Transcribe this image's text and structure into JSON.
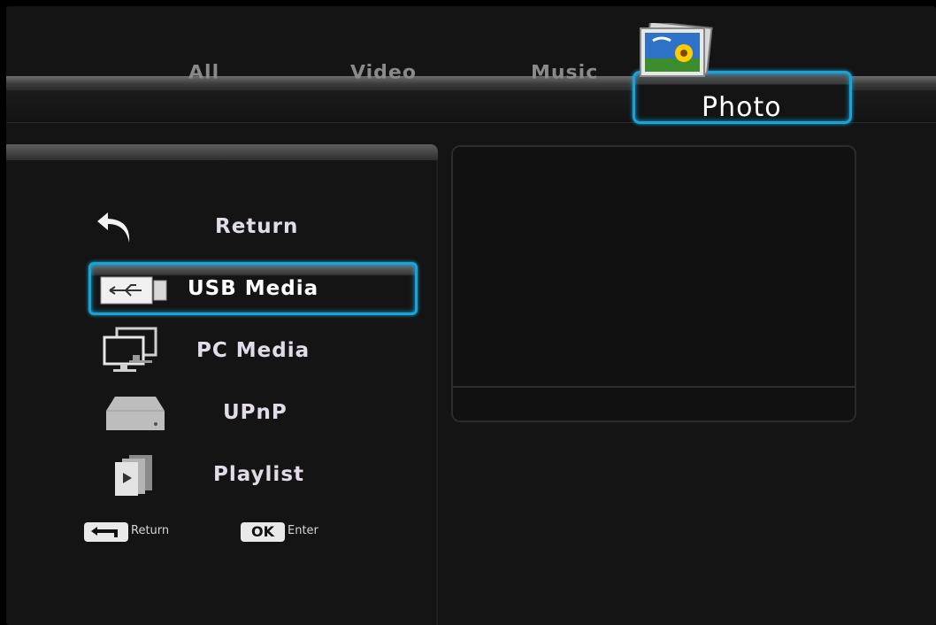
{
  "tabs": {
    "all": "All",
    "video": "Video",
    "music": "Music",
    "photo": "Photo",
    "selected": "Photo"
  },
  "menu": [
    {
      "label": "Return",
      "icon": "return-arrow-icon"
    },
    {
      "label": "USB Media",
      "icon": "usb-icon"
    },
    {
      "label": "PC Media",
      "icon": "pc-icon"
    },
    {
      "label": "UPnP",
      "icon": "upnp-drive-icon"
    },
    {
      "label": "Playlist",
      "icon": "playlist-icon"
    }
  ],
  "selected_item": "USB Media",
  "hints": {
    "return_label": "Return",
    "ok_key": "OK",
    "enter_label": "Enter"
  },
  "colors": {
    "highlight": "#1aa3d6",
    "background": "#141414",
    "text": "#e2dbe8"
  }
}
